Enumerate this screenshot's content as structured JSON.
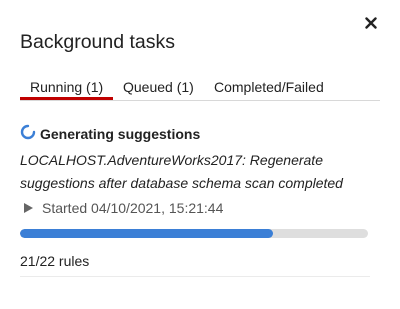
{
  "dialog": {
    "title": "Background tasks",
    "close_icon": "close-icon"
  },
  "tabs": [
    {
      "label": "Running (1)",
      "active": true
    },
    {
      "label": "Queued (1)",
      "active": false
    },
    {
      "label": "Completed/Failed",
      "active": false
    }
  ],
  "task": {
    "status_icon": "spinner-icon",
    "name": "Generating suggestions",
    "description": "LOCALHOST.AdventureWorks2017: Regenerate suggestions after database schema scan completed",
    "started_icon": "play-icon",
    "started": "Started 04/10/2021, 15:21:44",
    "progress_fraction": 0.727,
    "progress_text": "21/22 rules"
  },
  "colors": {
    "active_tab_underline": "#c00000",
    "progress_fill": "#3b7fd6",
    "progress_track": "#dedede",
    "spinner": "#3b7fd6"
  }
}
